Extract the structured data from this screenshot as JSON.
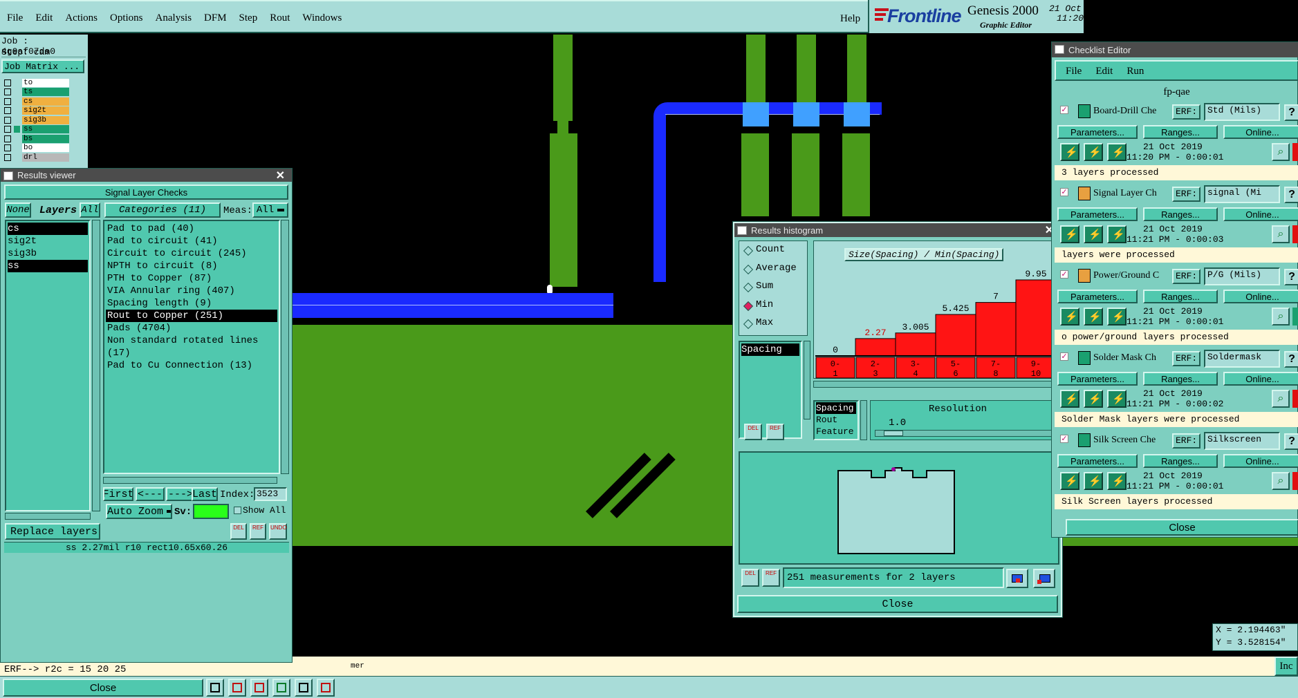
{
  "menubar": {
    "items": [
      "File",
      "Edit",
      "Actions",
      "Options",
      "Analysis",
      "DFM",
      "Step",
      "Rout",
      "Windows"
    ],
    "help": "Help"
  },
  "logo": {
    "brand": "Frontline",
    "product": "Genesis 2000",
    "subtitle": "Graphic Editor",
    "date": "21 Oct",
    "time": "11:20"
  },
  "job": {
    "job_label": "Job : 4g0af07da0",
    "step_label": "Step: cam",
    "matrix_button": "Job Matrix ..."
  },
  "layers": [
    {
      "name": "to",
      "color": "#ffffff"
    },
    {
      "name": "ts",
      "color": "#1aa070"
    },
    {
      "name": "cs",
      "color": "#f0b040"
    },
    {
      "name": "sig2t",
      "color": "#f0b040"
    },
    {
      "name": "sig3b",
      "color": "#f0b040"
    },
    {
      "name": "ss",
      "color": "#1aa070"
    },
    {
      "name": "bs",
      "color": "#1aa070"
    },
    {
      "name": "bo",
      "color": "#ffffff"
    },
    {
      "name": "drl",
      "color": "#b8b8b8"
    }
  ],
  "results_viewer": {
    "title": "Results viewer",
    "header": "Signal Layer Checks",
    "none_btn": "None",
    "layers_label": "Layers",
    "all_btn": "All",
    "categories_label": "Categories (11)",
    "meas_label": "Meas:",
    "meas_value": "All",
    "layer_list": [
      "cs",
      "sig2t",
      "sig3b",
      "ss"
    ],
    "categories": [
      "Pad to pad (40)",
      "Pad to circuit (41)",
      "Circuit to circuit (245)",
      "NPTH to circuit (8)",
      "PTH to Copper (87)",
      "VIA Annular ring (407)",
      "Spacing length (9)",
      "Rout to Copper (251)",
      "Pads (4704)",
      "Non standard rotated lines (17)",
      "Pad to Cu Connection (13)"
    ],
    "selected_category": "Rout to Copper (251)",
    "first_btn": "First",
    "prev_btn": "<---",
    "next_btn": "--->",
    "last_btn": "Last",
    "index_label": "Index:",
    "index_value": "3523",
    "auto_zoom": "Auto Zoom",
    "sv_label": "Sv:",
    "show_all": "Show All",
    "replace_layers": "Replace layers",
    "del": "DEL",
    "ref": "REF",
    "undo": "UNDO",
    "status": "ss 2.27mil  r10  rect10.65x60.26"
  },
  "erf_line": "ERF--> r2c = 15 20 25",
  "message_line": "mer",
  "close_label": "Close",
  "histogram": {
    "title": "Results histogram",
    "modes": [
      "Count",
      "Average",
      "Sum",
      "Min",
      "Max"
    ],
    "selected_mode": "Min",
    "list": [
      "Spacing"
    ],
    "chart_title": "Size(Spacing) / Min(Spacing)",
    "bins": [
      "0-1",
      "2-3",
      "3-4",
      "5-6",
      "7-8",
      "9-10"
    ],
    "values": [
      "0",
      "2.27",
      "3.005",
      "5.425",
      "7",
      "9.95"
    ],
    "value_colors": [
      "#000000",
      "#d00000",
      "#000000",
      "#000000",
      "#000000",
      "#000000"
    ],
    "type_options": [
      "Spacing",
      "Rout",
      "Feature"
    ],
    "resolution_label": "Resolution",
    "resolution_value": "1.0",
    "measurements": "251 measurements for 2 layers",
    "close": "Close",
    "chart_data": {
      "type": "bar",
      "categories": [
        "0-1",
        "2-3",
        "3-4",
        "5-6",
        "7-8",
        "9-10"
      ],
      "values": [
        0,
        2.27,
        3.005,
        5.425,
        7,
        9.95
      ],
      "title": "Size(Spacing) / Min(Spacing)",
      "ylim": [
        0,
        9.95
      ]
    }
  },
  "checklist": {
    "title": "Checklist Editor",
    "menu": [
      "File",
      "Edit",
      "Run"
    ],
    "name": "fp-qae",
    "erf_label": "ERF:",
    "params_btn": "Parameters...",
    "ranges_btn": "Ranges...",
    "online_btn": "Online...",
    "close": "Close",
    "items": [
      {
        "name": "Board-Drill Che",
        "erf": "Std (Mils)",
        "date": "21 Oct 2019",
        "time": "11:20 PM - 0:00:01",
        "status": "3 layers processed",
        "icon_color": "#1aa070"
      },
      {
        "name": "Signal Layer Ch",
        "erf": "signal (Mi",
        "date": "21 Oct 2019",
        "time": "11:21 PM - 0:00:03",
        "status": "layers were processed",
        "icon_color": "#e8a040"
      },
      {
        "name": "Power/Ground C",
        "erf": "P/G (Mils)",
        "date": "21 Oct 2019",
        "time": "11:21 PM - 0:00:01",
        "status": "o power/ground layers processed",
        "icon_color": "#e8a040"
      },
      {
        "name": "Solder Mask Ch",
        "erf": "Soldermask",
        "date": "21 Oct 2019",
        "time": "11:21 PM - 0:00:02",
        "status": "Solder Mask layers were processed",
        "icon_color": "#1aa070"
      },
      {
        "name": "Silk Screen Che",
        "erf": "Silkscreen",
        "date": "21 Oct 2019",
        "time": "11:21 PM - 0:00:01",
        "status": "Silk Screen layers processed",
        "icon_color": "#1aa070"
      }
    ]
  },
  "coords": {
    "x": "X = 2.194463\"",
    "y": "Y = 3.528154\""
  },
  "inc_btn": "Inc"
}
